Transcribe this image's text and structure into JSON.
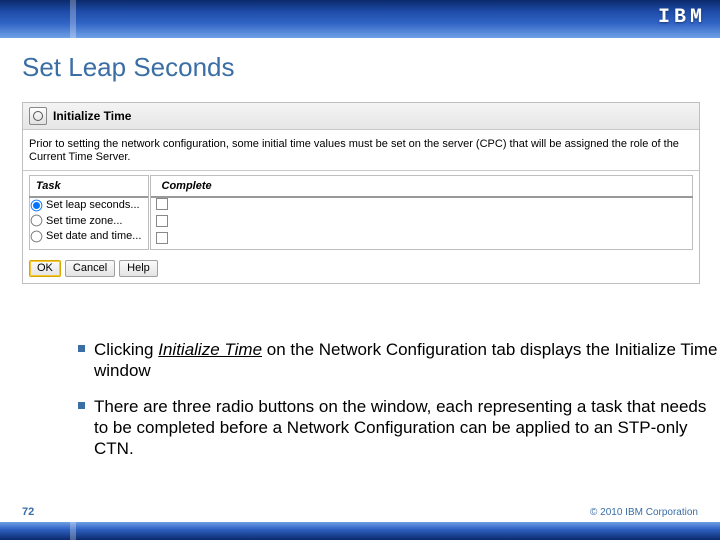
{
  "brand": "IBM",
  "title": "Set Leap Seconds",
  "panel": {
    "header": "Initialize Time",
    "intro": "Prior to setting the network configuration, some initial time values must be set on the server (CPC) that will be assigned the role of the Current Time Server.",
    "col_task": "Task",
    "col_complete": "Complete",
    "radio1": "Set leap seconds...",
    "radio2": "Set time zone...",
    "radio3": "Set date and time...",
    "btn_ok": "OK",
    "btn_cancel": "Cancel",
    "btn_help": "Help"
  },
  "bullets": {
    "b1_prefix": "Clicking ",
    "b1_em": "Initialize Time",
    "b1_suffix": " on the Network Configuration tab displays the Initialize Time window",
    "b2": "There are three radio buttons on the window, each representing a task that needs to be completed before a Network Configuration can be applied to an STP-only CTN."
  },
  "footer": {
    "page": "72",
    "copyright": "© 2010 IBM Corporation"
  }
}
